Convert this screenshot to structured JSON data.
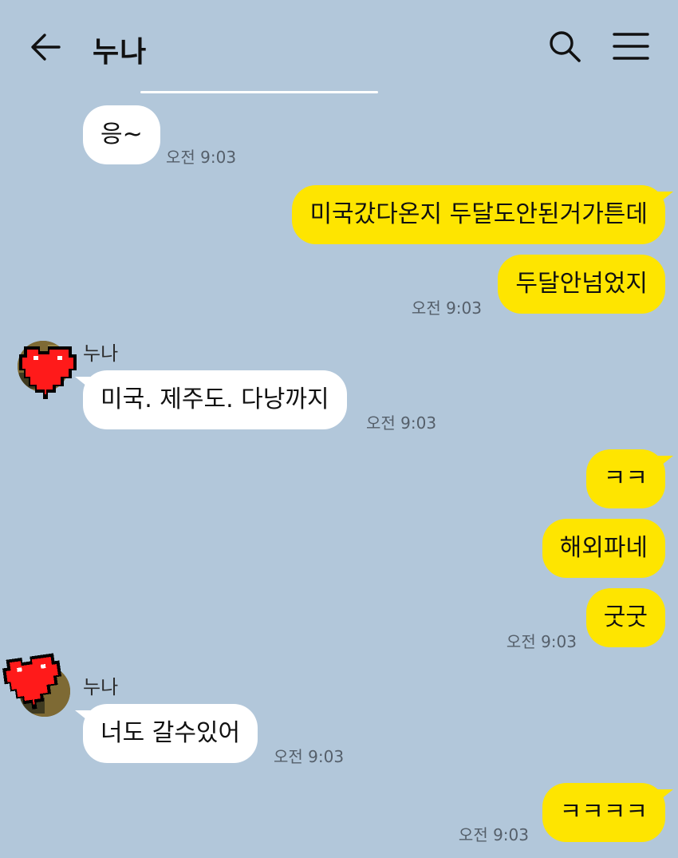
{
  "header": {
    "title": "누나",
    "icons": [
      "back-arrow-icon",
      "search-icon",
      "hamburger-menu-icon"
    ]
  },
  "colors": {
    "background": "#b2c7da",
    "incoming_bubble": "#ffffff",
    "outgoing_bubble": "#fee500",
    "avatar_heart": "#ff1a1a"
  },
  "messages": [
    {
      "direction": "incoming",
      "text": "응~",
      "time": "오전 9:03"
    },
    {
      "direction": "outgoing",
      "text": "미국갔다온지 두달도안된거가튼데",
      "time": ""
    },
    {
      "direction": "outgoing",
      "text": "두달안넘었지",
      "time": "오전 9:03"
    },
    {
      "direction": "incoming",
      "sender": "누나",
      "text": "미국. 제주도. 다낭까지",
      "time": "오전 9:03"
    },
    {
      "direction": "outgoing",
      "text": "ㅋㅋ",
      "time": ""
    },
    {
      "direction": "outgoing",
      "text": "해외파네",
      "time": ""
    },
    {
      "direction": "outgoing",
      "text": "굿굿",
      "time": "오전 9:03"
    },
    {
      "direction": "incoming",
      "sender": "누나",
      "text": "너도 갈수있어",
      "time": "오전 9:03"
    },
    {
      "direction": "outgoing",
      "text": "ㅋㅋㅋㅋ",
      "time": "오전 9:03"
    }
  ]
}
